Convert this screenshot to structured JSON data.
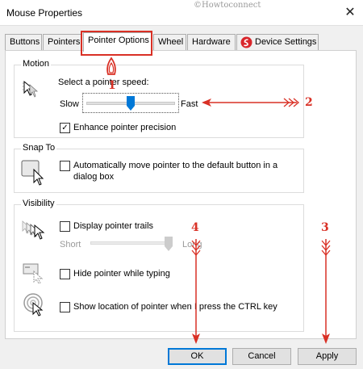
{
  "window": {
    "title": "Mouse Properties",
    "watermark": "©Howtoconnect",
    "close_glyph": "✕"
  },
  "tabs": [
    {
      "label": "Buttons"
    },
    {
      "label": "Pointers"
    },
    {
      "label": "Pointer Options",
      "active": true
    },
    {
      "label": "Wheel"
    },
    {
      "label": "Hardware"
    },
    {
      "label": "Device Settings",
      "icon": "synaptics-logo-icon"
    }
  ],
  "motion": {
    "legend": "Motion",
    "prompt": "Select a pointer speed:",
    "slow_label": "Slow",
    "fast_label": "Fast",
    "speed_fraction": 0.5,
    "enhance_label": "Enhance pointer precision",
    "enhance_checked": true
  },
  "snap_to": {
    "legend": "Snap To",
    "label_line1": "Automatically move pointer to the default button in a",
    "label_line2": "dialog box",
    "checked": false
  },
  "visibility": {
    "legend": "Visibility",
    "trails_label": "Display pointer trails",
    "trails_checked": false,
    "short_label": "Short",
    "long_label": "Long",
    "trail_fraction": 1.0,
    "hide_label": "Hide pointer while typing",
    "hide_checked": false,
    "ctrl_label": "Show location of pointer when I press the CTRL key",
    "ctrl_checked": false
  },
  "buttons": {
    "ok": "OK",
    "cancel": "Cancel",
    "apply": "Apply"
  },
  "annotations": {
    "marker_1": "1",
    "marker_2": "2",
    "marker_3": "3",
    "marker_4": "4",
    "color": "#d93025"
  }
}
